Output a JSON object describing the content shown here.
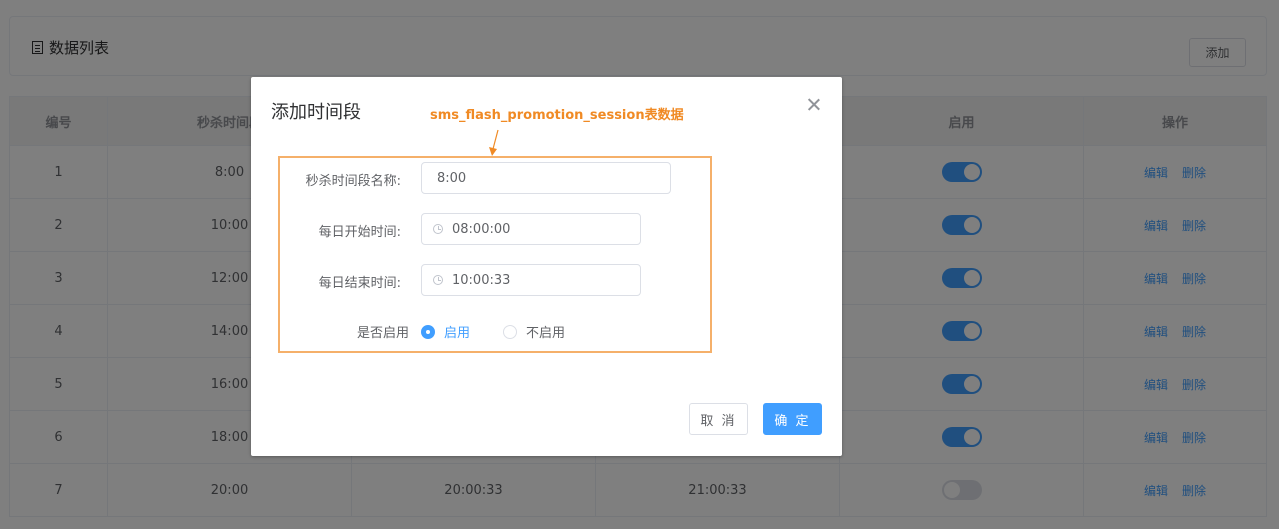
{
  "header": {
    "title": "数据列表",
    "add_label": "添加"
  },
  "table": {
    "columns": [
      "编号",
      "秒杀时间段",
      "",
      "",
      "启用",
      "操作"
    ],
    "rows": [
      {
        "id": "1",
        "name": "8:00",
        "start": "",
        "end": "",
        "enabled": true
      },
      {
        "id": "2",
        "name": "10:00",
        "start": "",
        "end": "",
        "enabled": true
      },
      {
        "id": "3",
        "name": "12:00",
        "start": "",
        "end": "",
        "enabled": true
      },
      {
        "id": "4",
        "name": "14:00",
        "start": "",
        "end": "",
        "enabled": true
      },
      {
        "id": "5",
        "name": "16:00",
        "start": "",
        "end": "",
        "enabled": true
      },
      {
        "id": "6",
        "name": "18:00",
        "start": "",
        "end": "",
        "enabled": true
      },
      {
        "id": "7",
        "name": "20:00",
        "start": "20:00:33",
        "end": "21:00:33",
        "enabled": false
      }
    ],
    "edit_label": "编辑",
    "delete_label": "删除"
  },
  "dialog": {
    "title": "添加时间段",
    "annotation": "sms_flash_promotion_session表数据",
    "name_label": "秒杀时间段名称:",
    "name_value": "8:00",
    "start_label": "每日开始时间:",
    "start_value": "08:00:00",
    "end_label": "每日结束时间:",
    "end_value": "10:00:33",
    "status_label": "是否启用",
    "enable_label": "启用",
    "disable_label": "不启用",
    "cancel_label": "取 消",
    "ok_label": "确 定"
  },
  "colors": {
    "primary": "#409eff",
    "annotation": "#f08a24"
  }
}
